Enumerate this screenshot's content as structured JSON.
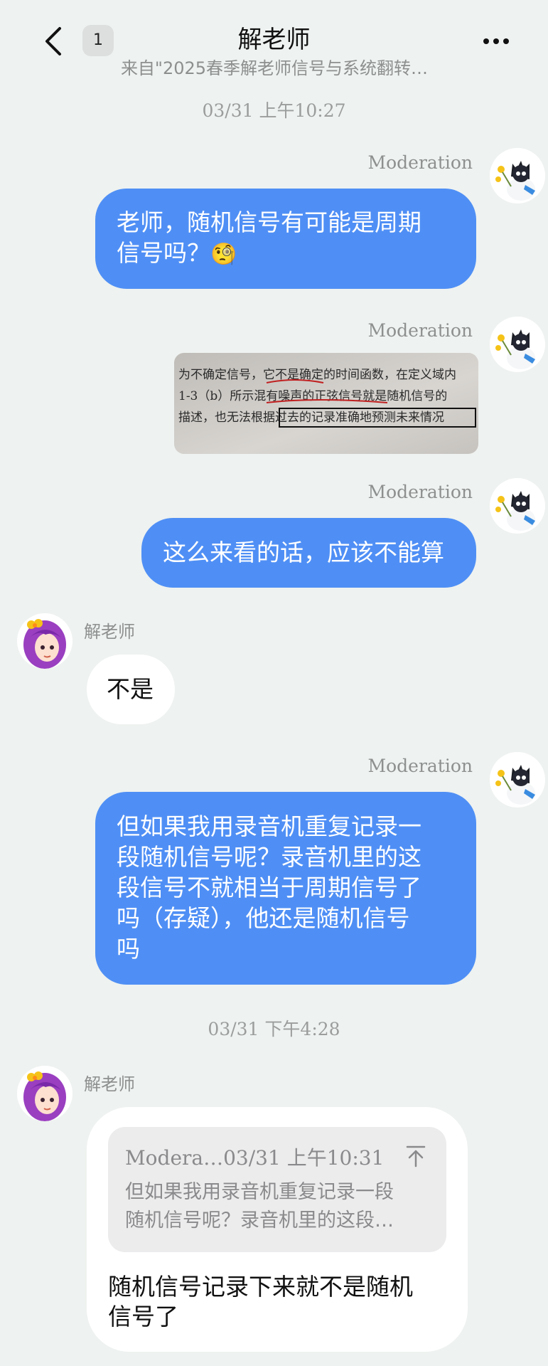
{
  "header": {
    "unread_count": "1",
    "title": "解老师",
    "subtitle": "来自\"2025春季解老师信号与系统翻转…"
  },
  "messages": {
    "time1": "03/31 上午10:27",
    "m1_sender": "Moderation",
    "m1_line1": "老师，随机信号有可能是周期",
    "m1_line2": "信号吗？",
    "m1_emoji": "🧐",
    "m2_sender": "Moderation",
    "m3_sender": "Moderation",
    "m3_text": "这么来看的话，应该不能算",
    "m4_sender": "解老师",
    "m4_text": "不是",
    "m5_sender": "Moderation",
    "m5_lines": [
      "但如果我用录音机重复记录一",
      "段随机信号呢？录音机里的这",
      "段信号不就相当于周期信号了",
      "吗（存疑），他还是随机信号",
      "吗"
    ],
    "time2": "03/31 下午4:28",
    "m6_sender": "解老师",
    "m6_quote_header": "Modera…03/31 上午10:31",
    "m6_quote_line1": "但如果我用录音机重复记录一段",
    "m6_quote_line2": "随机信号呢？录音机里的这段…",
    "m6_reply_line1": "随机信号记录下来就不是随机",
    "m6_reply_line2": "信号了"
  },
  "photo_text": {
    "line1": "为不确定信号，它不是确定的时间函数，在定义域内",
    "line2": "1-3（b）所示混有噪声的正弦信号就是随机信号的",
    "line3": "描述，也无法根据过去的记录准确地预测未来情况"
  },
  "colors": {
    "background": "#eef2f0",
    "outgoing_bubble": "#4f8ff5",
    "incoming_bubble": "#ffffff",
    "meta_text": "#8d908f"
  }
}
